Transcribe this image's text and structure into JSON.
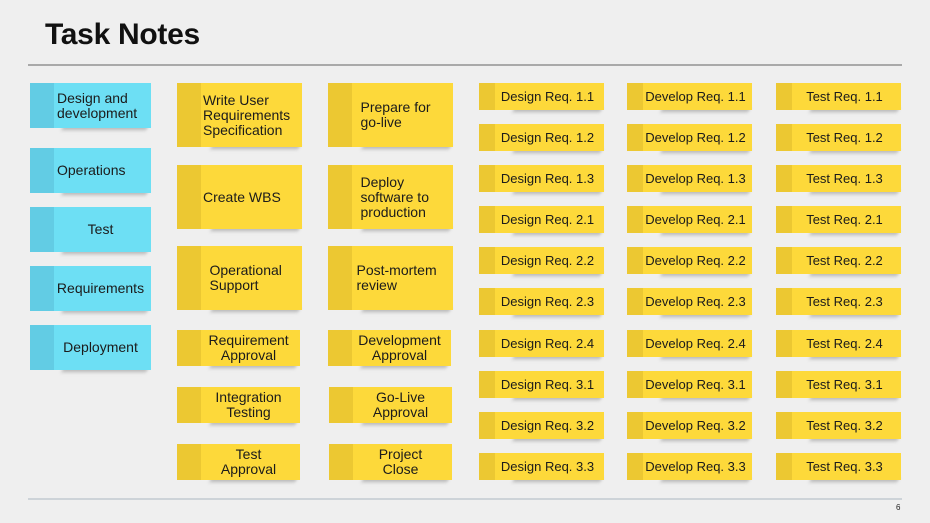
{
  "title": "Task Notes",
  "page_number": "6",
  "colors": {
    "blue_note": "#6ddff4",
    "yellow_note": "#fdd93a",
    "background": "#efefef"
  },
  "categories": [
    "Design and development",
    "Operations",
    "Test",
    "Requirements",
    "Deployment"
  ],
  "tasks_col1": [
    "Write User Requirements Specification",
    "Create WBS",
    "Operational Support",
    "Requirement Approval",
    "Integration Testing",
    "Test Approval"
  ],
  "tasks_col2": [
    "Prepare for go-live",
    "Deploy software to production",
    "Post-mortem review",
    "Development Approval",
    "Go-Live Approval",
    "Project Close"
  ],
  "design_reqs": [
    "Design Req. 1.1",
    "Design Req. 1.2",
    "Design Req. 1.3",
    "Design Req. 2.1",
    "Design Req. 2.2",
    "Design Req. 2.3",
    "Design Req. 2.4",
    "Design Req. 3.1",
    "Design Req. 3.2",
    "Design Req. 3.3"
  ],
  "develop_reqs": [
    "Develop Req. 1.1",
    "Develop Req. 1.2",
    "Develop Req. 1.3",
    "Develop Req. 2.1",
    "Develop Req. 2.2",
    "Develop Req. 2.3",
    "Develop Req. 2.4",
    "Develop Req. 3.1",
    "Develop Req. 3.2",
    "Develop Req. 3.3"
  ],
  "test_reqs": [
    "Test Req. 1.1",
    "Test Req. 1.2",
    "Test Req. 1.3",
    "Test Req. 2.1",
    "Test Req. 2.2",
    "Test Req. 2.3",
    "Test Req. 2.4",
    "Test Req. 3.1",
    "Test Req. 3.2",
    "Test Req. 3.3"
  ]
}
